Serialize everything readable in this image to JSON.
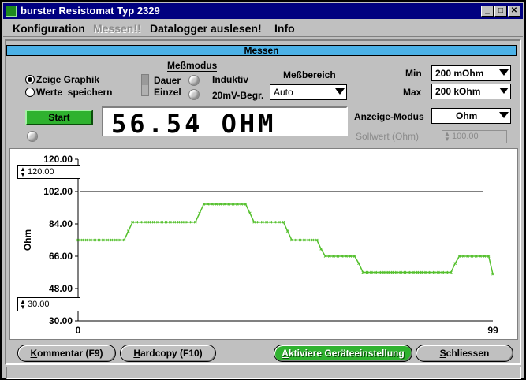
{
  "window": {
    "title": "burster Resistomat Typ 2329"
  },
  "menu": [
    {
      "label": "Konfiguration",
      "enabled": true
    },
    {
      "label": "Messen!!",
      "enabled": false
    },
    {
      "label": "Datalogger auslesen!",
      "enabled": true
    },
    {
      "label": "Info",
      "enabled": true
    }
  ],
  "panel": {
    "title": "Messen"
  },
  "view_mode": {
    "graph_label": "Zeige Graphik",
    "save_label": "Werte  speichern",
    "selected": "graph"
  },
  "messmodus": {
    "title": "Meßmodus",
    "dauer": "Dauer",
    "einzel": "Einzel",
    "induktiv": "Induktiv",
    "begr": "20mV-Begr."
  },
  "messbereich": {
    "label": "Meßbereich",
    "value": "Auto"
  },
  "range": {
    "min_label": "Min",
    "min_value": "200 mOhm",
    "max_label": "Max",
    "max_value": "200 kOhm"
  },
  "start_label": "Start",
  "reading": "56.54 OHM",
  "anzeige": {
    "label": "Anzeige-Modus",
    "value": "Ohm"
  },
  "sollwert": {
    "label": "Sollwert (Ohm)",
    "value": "100.00"
  },
  "chart_spin": {
    "upper": "120.00",
    "lower": "30.00"
  },
  "chart_data": {
    "type": "line",
    "ylabel": "Ohm",
    "ylim": [
      30,
      120
    ],
    "xlim": [
      0,
      99
    ],
    "yticks": [
      "120.00",
      "102.00",
      "84.00",
      "66.00",
      "48.00",
      "30.00"
    ],
    "xticks": [
      "0",
      "99"
    ],
    "reference_lines": [
      102,
      50
    ],
    "colors": {
      "series": "#55c02e",
      "reference": "#000000"
    },
    "x": [
      0,
      1,
      2,
      3,
      4,
      5,
      6,
      7,
      8,
      9,
      10,
      11,
      12,
      13,
      14,
      15,
      16,
      17,
      18,
      19,
      20,
      21,
      22,
      23,
      24,
      25,
      26,
      27,
      28,
      29,
      30,
      31,
      32,
      33,
      34,
      35,
      36,
      37,
      38,
      39,
      40,
      41,
      42,
      43,
      44,
      45,
      46,
      47,
      48,
      49,
      50,
      51,
      52,
      53,
      54,
      55,
      56,
      57,
      58,
      59,
      60,
      61,
      62,
      63,
      64,
      65,
      66,
      67,
      68,
      69,
      70,
      71,
      72,
      73,
      74,
      75,
      76,
      77,
      78,
      79,
      80,
      81,
      82,
      83,
      84,
      85,
      86,
      87,
      88,
      89,
      90,
      91,
      92,
      93,
      94,
      95,
      96,
      97,
      98,
      99
    ],
    "values": [
      75,
      75,
      75,
      75,
      75,
      75,
      75,
      75,
      75,
      75,
      75,
      75,
      80,
      85,
      85,
      85,
      85,
      85,
      85,
      85,
      85,
      85,
      85,
      85,
      85,
      85,
      85,
      85,
      85,
      90,
      95,
      95,
      95,
      95,
      95,
      95,
      95,
      95,
      95,
      95,
      95,
      90,
      85,
      85,
      85,
      85,
      85,
      85,
      85,
      85,
      80,
      75,
      75,
      75,
      75,
      75,
      75,
      75,
      70,
      66,
      66,
      66,
      66,
      66,
      66,
      66,
      66,
      62,
      57,
      57,
      57,
      57,
      57,
      57,
      57,
      57,
      57,
      57,
      57,
      57,
      57,
      57,
      57,
      57,
      57,
      57,
      57,
      57,
      57,
      57,
      62,
      66,
      66,
      66,
      66,
      66,
      66,
      66,
      66,
      56
    ]
  }
}
